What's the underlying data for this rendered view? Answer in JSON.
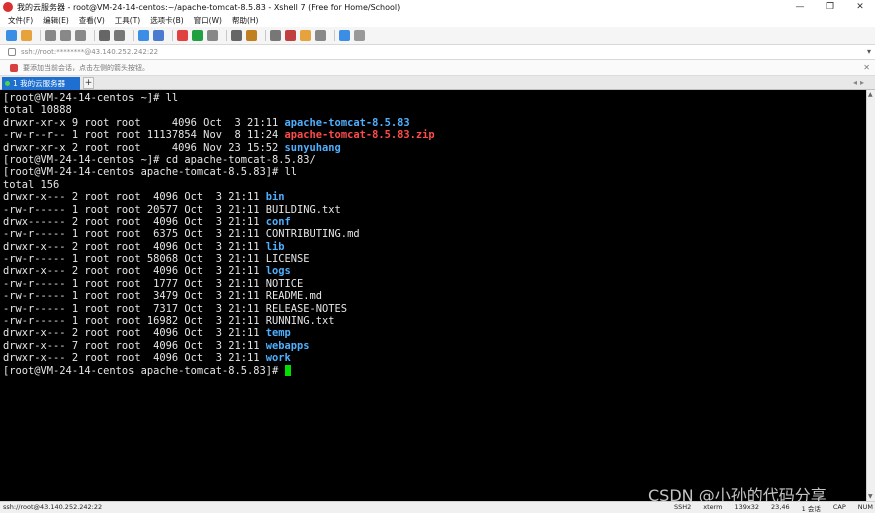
{
  "window": {
    "title": "我的云服务器 - root@VM-24-14-centos:~/apache-tomcat-8.5.83 - Xshell 7 (Free for Home/School)",
    "controls": [
      "—",
      "❐",
      "✕"
    ]
  },
  "menu": [
    "文件(F)",
    "编辑(E)",
    "查看(V)",
    "工具(T)",
    "选项卡(B)",
    "窗口(W)",
    "帮助(H)"
  ],
  "toolbar": {
    "icons": [
      {
        "name": "new-session-icon",
        "color": "#3a8ee6"
      },
      {
        "name": "open-icon",
        "color": "#e6a23c"
      },
      {
        "name": "reconnect-icon",
        "color": "#888888"
      },
      {
        "name": "copy-icon",
        "color": "#888888"
      },
      {
        "name": "paste-icon",
        "color": "#888888"
      },
      {
        "name": "find-icon",
        "color": "#666666"
      },
      {
        "name": "print-icon",
        "color": "#777777"
      },
      {
        "name": "color-scheme-icon",
        "color": "#3a8ee6"
      },
      {
        "name": "font-icon",
        "color": "#4a7bd0"
      },
      {
        "name": "xftp-icon",
        "color": "#e04040"
      },
      {
        "name": "xmanager-icon",
        "color": "#20a040"
      },
      {
        "name": "compose-icon",
        "color": "#888888"
      },
      {
        "name": "fullscreen-icon",
        "color": "#666666"
      },
      {
        "name": "lock-icon",
        "color": "#c08020"
      },
      {
        "name": "keyboard-icon",
        "color": "#777777"
      },
      {
        "name": "script-icon",
        "color": "#c04040"
      },
      {
        "name": "transfer-icon",
        "color": "#e6a23c"
      },
      {
        "name": "layout-icon",
        "color": "#888888"
      },
      {
        "name": "help-icon",
        "color": "#3a8ee6"
      },
      {
        "name": "chat-icon",
        "color": "#999999"
      }
    ]
  },
  "address": {
    "value": "ssh://root:********@43.140.252.242:22"
  },
  "hint": {
    "text": "要添加当前会话，点击左侧的箭头按钮。"
  },
  "tabs": [
    {
      "label": "1 我的云服务器",
      "active": true
    }
  ],
  "terminal": {
    "lines": [
      [
        {
          "t": "[root@VM-24-14-centos ~]# ll"
        }
      ],
      [
        {
          "t": "total 10888"
        }
      ],
      [
        {
          "t": "drwxr-xr-x 9 root root     4096 Oct  3 21:11 "
        },
        {
          "t": "apache-tomcat-8.5.83",
          "c": "dir"
        }
      ],
      [
        {
          "t": "-rw-r--r-- 1 root root 11137854 Nov  8 11:24 "
        },
        {
          "t": "apache-tomcat-8.5.83.zip",
          "c": "zip"
        }
      ],
      [
        {
          "t": "drwxr-xr-x 2 root root     4096 Nov 23 15:52 "
        },
        {
          "t": "sunyuhang",
          "c": "dir"
        }
      ],
      [
        {
          "t": "[root@VM-24-14-centos ~]# cd apache-tomcat-8.5.83/"
        }
      ],
      [
        {
          "t": "[root@VM-24-14-centos apache-tomcat-8.5.83]# ll"
        }
      ],
      [
        {
          "t": "total 156"
        }
      ],
      [
        {
          "t": "drwxr-x--- 2 root root  4096 Oct  3 21:11 "
        },
        {
          "t": "bin",
          "c": "dir"
        }
      ],
      [
        {
          "t": "-rw-r----- 1 root root 20577 Oct  3 21:11 BUILDING.txt"
        }
      ],
      [
        {
          "t": "drwx------ 2 root root  4096 Oct  3 21:11 "
        },
        {
          "t": "conf",
          "c": "dir"
        }
      ],
      [
        {
          "t": "-rw-r----- 1 root root  6375 Oct  3 21:11 CONTRIBUTING.md"
        }
      ],
      [
        {
          "t": "drwxr-x--- 2 root root  4096 Oct  3 21:11 "
        },
        {
          "t": "lib",
          "c": "dir"
        }
      ],
      [
        {
          "t": "-rw-r----- 1 root root 58068 Oct  3 21:11 LICENSE"
        }
      ],
      [
        {
          "t": "drwxr-x--- 2 root root  4096 Oct  3 21:11 "
        },
        {
          "t": "logs",
          "c": "dir"
        }
      ],
      [
        {
          "t": "-rw-r----- 1 root root  1777 Oct  3 21:11 NOTICE"
        }
      ],
      [
        {
          "t": "-rw-r----- 1 root root  3479 Oct  3 21:11 README.md"
        }
      ],
      [
        {
          "t": "-rw-r----- 1 root root  7317 Oct  3 21:11 RELEASE-NOTES"
        }
      ],
      [
        {
          "t": "-rw-r----- 1 root root 16982 Oct  3 21:11 RUNNING.txt"
        }
      ],
      [
        {
          "t": "drwxr-x--- 2 root root  4096 Oct  3 21:11 "
        },
        {
          "t": "temp",
          "c": "dir"
        }
      ],
      [
        {
          "t": "drwxr-x--- 7 root root  4096 Oct  3 21:11 "
        },
        {
          "t": "webapps",
          "c": "dir"
        }
      ],
      [
        {
          "t": "drwxr-x--- 2 root root  4096 Oct  3 21:11 "
        },
        {
          "t": "work",
          "c": "dir"
        }
      ],
      [
        {
          "t": "[root@VM-24-14-centos apache-tomcat-8.5.83]# "
        },
        {
          "t": "",
          "c": "cursor"
        }
      ]
    ]
  },
  "watermark": "CSDN @小孙的代码分享",
  "status": {
    "left": "ssh://root@43.140.252.242:22",
    "right": [
      "SSH2",
      "xterm",
      "139x32",
      "23,46",
      "1 会话",
      "CAP",
      "NUM"
    ]
  },
  "colors": {
    "dir": "#4fb0ff",
    "zip": "#ff4b4b",
    "cursor": "#00e000",
    "tab_active": "#1e6fd0"
  }
}
